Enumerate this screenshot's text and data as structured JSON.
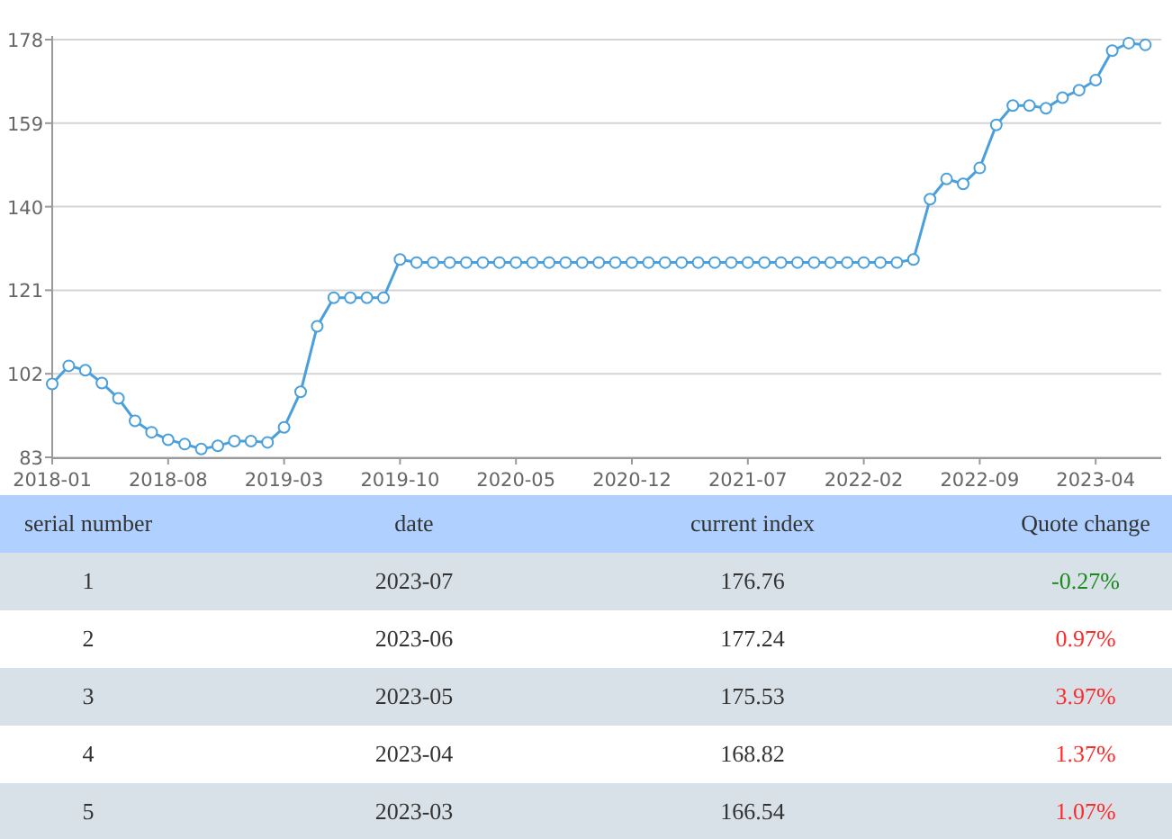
{
  "chart": {
    "chart_data": {
      "type": "line",
      "grid": true,
      "categories": [
        "2018-01",
        null,
        null,
        null,
        null,
        null,
        null,
        "2018-08",
        null,
        null,
        null,
        null,
        null,
        null,
        "2019-03",
        null,
        null,
        null,
        null,
        null,
        null,
        "2019-10",
        null,
        null,
        null,
        null,
        null,
        null,
        "2020-05",
        null,
        null,
        null,
        null,
        null,
        null,
        "2020-12",
        null,
        null,
        null,
        null,
        null,
        null,
        "2021-07",
        null,
        null,
        null,
        null,
        null,
        null,
        "2022-02",
        null,
        null,
        null,
        null,
        null,
        null,
        "2022-09",
        null,
        null,
        null,
        null,
        null,
        null,
        "2023-04",
        null,
        null,
        null
      ],
      "series": [
        {
          "color": "#4a9fdc",
          "marker": "circle",
          "values": [
            99.7,
            103.8,
            102.8,
            99.9,
            96.4,
            91.3,
            88.7,
            87.0,
            86.0,
            84.9,
            85.6,
            86.7,
            86.7,
            86.4,
            89.8,
            97.9,
            112.8,
            119.3,
            119.3,
            119.3,
            119.3,
            128.0,
            127.3,
            127.3,
            127.3,
            127.3,
            127.3,
            127.3,
            127.3,
            127.3,
            127.3,
            127.3,
            127.3,
            127.3,
            127.3,
            127.3,
            127.3,
            127.3,
            127.3,
            127.3,
            127.3,
            127.3,
            127.3,
            127.3,
            127.3,
            127.3,
            127.3,
            127.3,
            127.3,
            127.3,
            127.3,
            127.3,
            128.0,
            141.7,
            146.3,
            145.2,
            148.8,
            158.6,
            163.0,
            163.0,
            162.4,
            164.8,
            166.5,
            168.8,
            175.5,
            177.2,
            176.8
          ]
        }
      ],
      "ylim": [
        83,
        178
      ],
      "yticks": [
        83,
        102,
        121,
        140,
        159,
        178
      ]
    }
  },
  "table": {
    "columns": [
      "serial number",
      "date",
      "current index",
      "Quote change"
    ],
    "rows": [
      {
        "serial": "1",
        "date": "2023-07",
        "index": "176.76",
        "change": "-0.27%",
        "color": "#1a8a1a"
      },
      {
        "serial": "2",
        "date": "2023-06",
        "index": "177.24",
        "change": "0.97%",
        "color": "#ff2a2a"
      },
      {
        "serial": "3",
        "date": "2023-05",
        "index": "175.53",
        "change": "3.97%",
        "color": "#ff2a2a"
      },
      {
        "serial": "4",
        "date": "2023-04",
        "index": "168.82",
        "change": "1.37%",
        "color": "#ff2a2a"
      },
      {
        "serial": "5",
        "date": "2023-03",
        "index": "166.54",
        "change": "1.07%",
        "color": "#ff2a2a"
      }
    ]
  }
}
